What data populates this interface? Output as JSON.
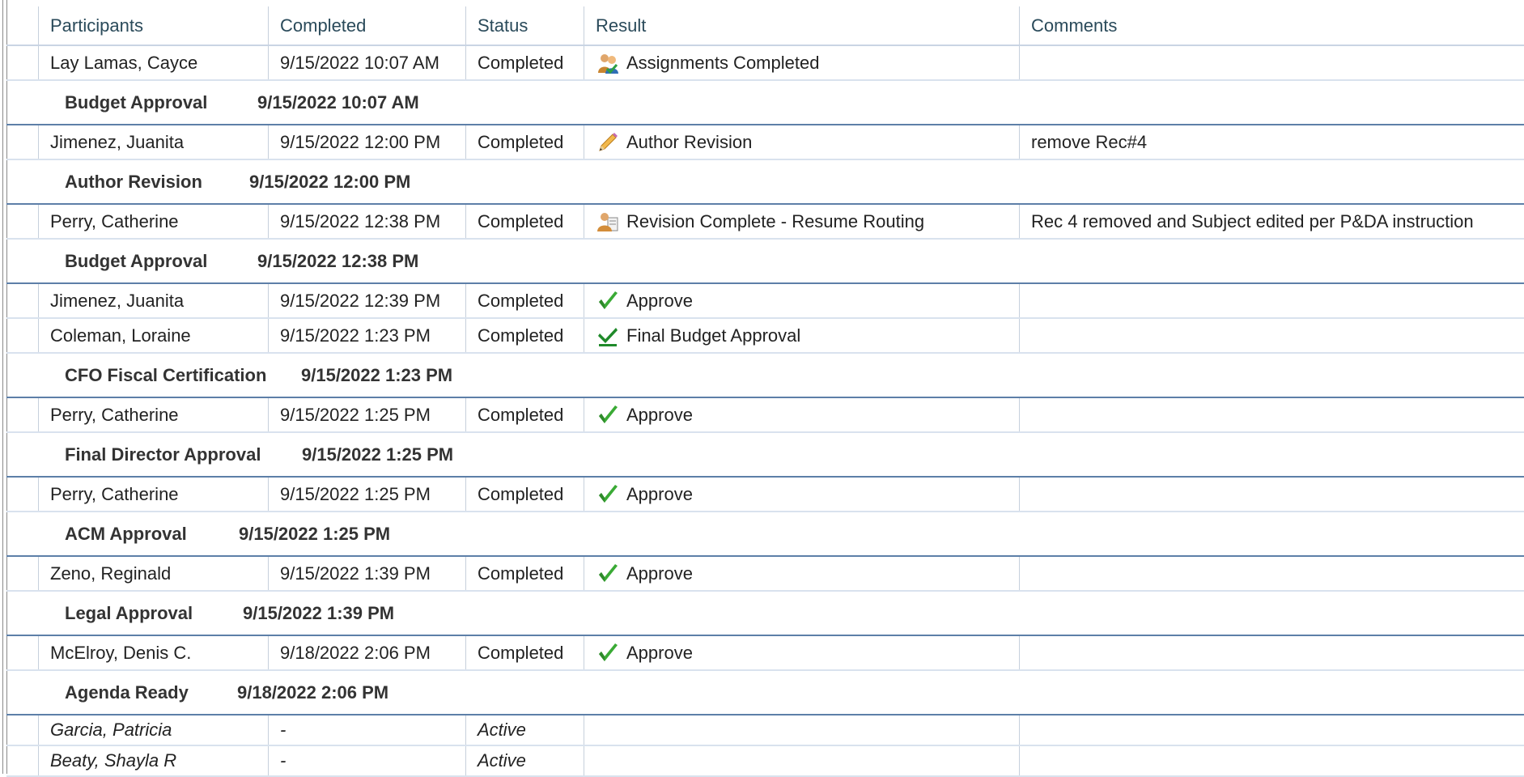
{
  "columns": {
    "participants": "Participants",
    "completed": "Completed",
    "status": "Status",
    "result": "Result",
    "comments": "Comments"
  },
  "rows": [
    {
      "kind": "data",
      "participant": "Lay Lamas, Cayce",
      "completed": "9/15/2022 10:07 AM",
      "status": "Completed",
      "result": "Assignments Completed",
      "icon": "users-icon",
      "comment": ""
    },
    {
      "kind": "group",
      "name": "Budget Approval",
      "date": "9/15/2022 10:07 AM"
    },
    {
      "kind": "data",
      "participant": "Jimenez, Juanita",
      "completed": "9/15/2022 12:00 PM",
      "status": "Completed",
      "result": "Author Revision",
      "icon": "pencil-icon",
      "comment": "remove Rec#4"
    },
    {
      "kind": "group",
      "name": "Author Revision",
      "date": "9/15/2022 12:00 PM"
    },
    {
      "kind": "data",
      "participant": "Perry, Catherine",
      "completed": "9/15/2022 12:38 PM",
      "status": "Completed",
      "result": "Revision Complete - Resume Routing",
      "icon": "user-document-icon",
      "comment": "Rec 4 removed and Subject edited per P&DA instruction"
    },
    {
      "kind": "group",
      "name": "Budget Approval",
      "date": "9/15/2022 12:38 PM"
    },
    {
      "kind": "data",
      "participant": "Jimenez, Juanita",
      "completed": "9/15/2022 12:39 PM",
      "status": "Completed",
      "result": "Approve",
      "icon": "checkmark-icon",
      "comment": ""
    },
    {
      "kind": "data",
      "participant": "Coleman, Loraine",
      "completed": "9/15/2022 1:23 PM",
      "status": "Completed",
      "result": "Final Budget Approval",
      "icon": "check-underline-icon",
      "comment": ""
    },
    {
      "kind": "group",
      "name": "CFO Fiscal Certification",
      "date": "9/15/2022 1:23 PM"
    },
    {
      "kind": "data",
      "participant": "Perry, Catherine",
      "completed": "9/15/2022 1:25 PM",
      "status": "Completed",
      "result": "Approve",
      "icon": "checkmark-icon",
      "comment": ""
    },
    {
      "kind": "group",
      "name": "Final Director Approval",
      "date": "9/15/2022 1:25 PM"
    },
    {
      "kind": "data",
      "participant": "Perry, Catherine",
      "completed": "9/15/2022 1:25 PM",
      "status": "Completed",
      "result": "Approve",
      "icon": "checkmark-icon",
      "comment": ""
    },
    {
      "kind": "group",
      "name": "ACM Approval",
      "date": "9/15/2022 1:25 PM"
    },
    {
      "kind": "data",
      "participant": "Zeno, Reginald",
      "completed": "9/15/2022 1:39 PM",
      "status": "Completed",
      "result": "Approve",
      "icon": "checkmark-icon",
      "comment": ""
    },
    {
      "kind": "group",
      "name": "Legal Approval",
      "date": "9/15/2022 1:39 PM"
    },
    {
      "kind": "data",
      "participant": "McElroy, Denis C.",
      "completed": "9/18/2022 2:06 PM",
      "status": "Completed",
      "result": "Approve",
      "icon": "checkmark-icon",
      "comment": ""
    },
    {
      "kind": "group",
      "name": "Agenda Ready",
      "date": "9/18/2022 2:06 PM"
    },
    {
      "kind": "active",
      "participant": "Garcia, Patricia",
      "completed": "-",
      "status": "Active",
      "result": "",
      "comment": ""
    },
    {
      "kind": "active",
      "participant": "Beaty, Shayla R",
      "completed": "-",
      "status": "Active",
      "result": "",
      "comment": ""
    }
  ]
}
